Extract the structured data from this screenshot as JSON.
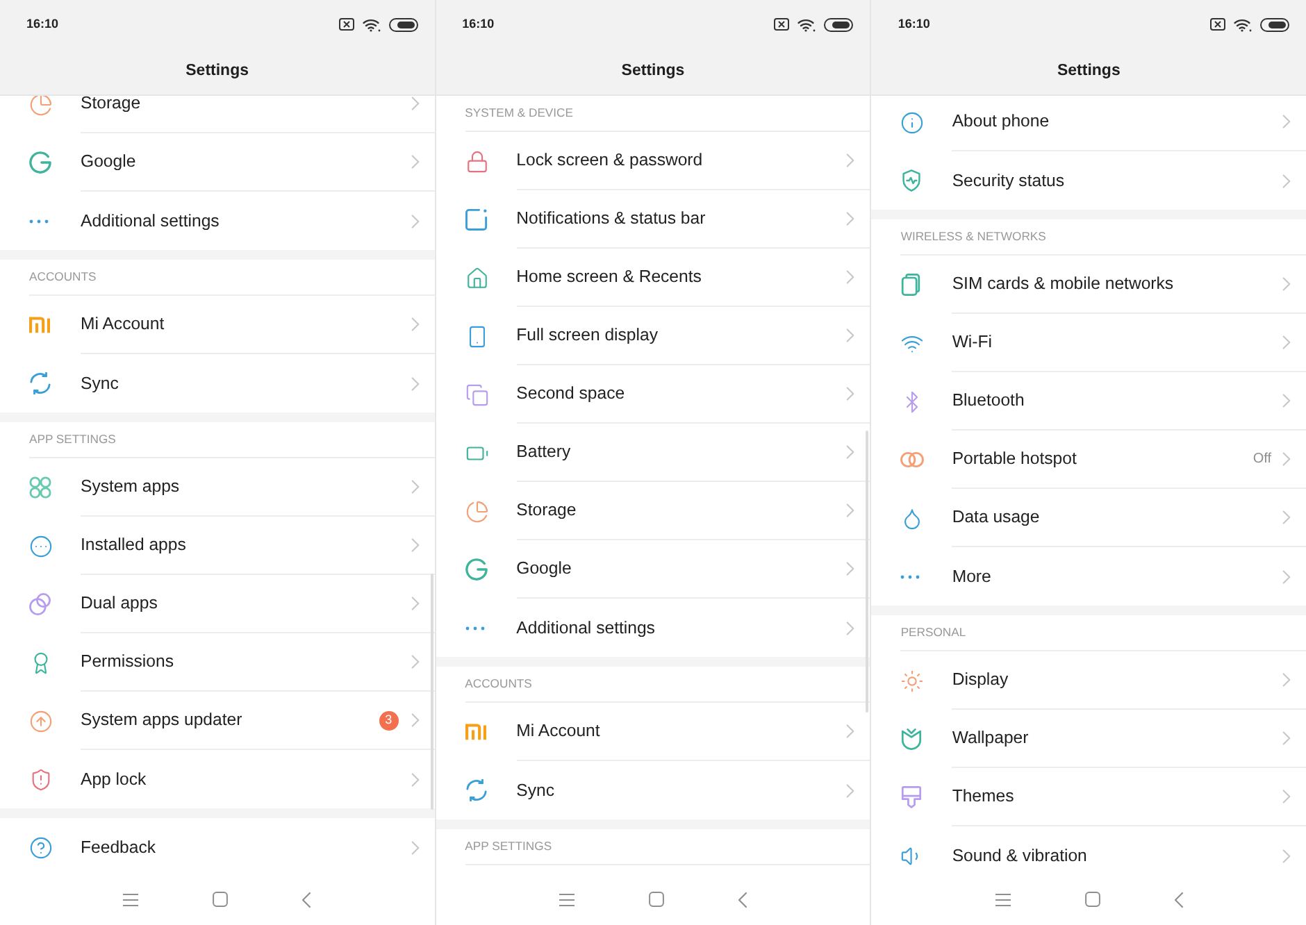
{
  "screens": [
    {
      "status_bar": {
        "time": "16:10"
      },
      "title": "Settings",
      "sections": [
        {
          "items": [
            {
              "label": "Storage"
            },
            {
              "label": "Google"
            },
            {
              "label": "Additional settings"
            }
          ]
        },
        {
          "header": "ACCOUNTS",
          "items": [
            {
              "label": "Mi Account"
            },
            {
              "label": "Sync"
            }
          ]
        },
        {
          "header": "APP SETTINGS",
          "items": [
            {
              "label": "System apps"
            },
            {
              "label": "Installed apps"
            },
            {
              "label": "Dual apps"
            },
            {
              "label": "Permissions"
            },
            {
              "label": "System apps updater",
              "badge": "3"
            },
            {
              "label": "App lock"
            }
          ]
        },
        {
          "items": [
            {
              "label": "Feedback"
            }
          ]
        }
      ]
    },
    {
      "status_bar": {
        "time": "16:10"
      },
      "title": "Settings",
      "sections": [
        {
          "header": "SYSTEM & DEVICE",
          "items": [
            {
              "label": "Lock screen & password"
            },
            {
              "label": "Notifications & status bar"
            },
            {
              "label": "Home screen & Recents"
            },
            {
              "label": "Full screen display"
            },
            {
              "label": "Second space"
            },
            {
              "label": "Battery"
            },
            {
              "label": "Storage"
            },
            {
              "label": "Google"
            },
            {
              "label": "Additional settings"
            }
          ]
        },
        {
          "header": "ACCOUNTS",
          "items": [
            {
              "label": "Mi Account"
            },
            {
              "label": "Sync"
            }
          ]
        },
        {
          "header": "APP SETTINGS"
        }
      ]
    },
    {
      "status_bar": {
        "time": "16:10"
      },
      "title": "Settings",
      "sections": [
        {
          "items": [
            {
              "label": "About phone"
            },
            {
              "label": "Security status"
            }
          ]
        },
        {
          "header": "WIRELESS & NETWORKS",
          "items": [
            {
              "label": "SIM cards & mobile networks"
            },
            {
              "label": "Wi-Fi"
            },
            {
              "label": "Bluetooth"
            },
            {
              "label": "Portable hotspot",
              "value": "Off"
            },
            {
              "label": "Data usage"
            },
            {
              "label": "More"
            }
          ]
        },
        {
          "header": "PERSONAL",
          "items": [
            {
              "label": "Display"
            },
            {
              "label": "Wallpaper"
            },
            {
              "label": "Themes"
            },
            {
              "label": "Sound & vibration"
            }
          ]
        }
      ]
    }
  ]
}
